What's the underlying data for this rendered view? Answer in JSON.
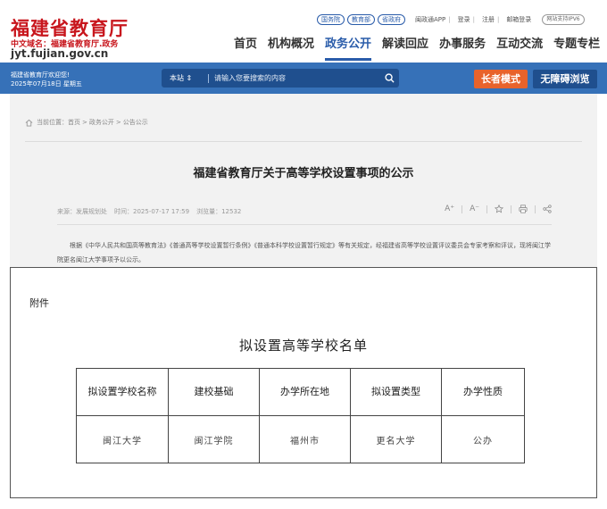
{
  "header": {
    "logo_title": "福建省教育厅",
    "logo_cn_domain": "中文域名：福建省教育厅.政务",
    "logo_domain": "jyt.fujian.gov.cn",
    "gov_links": [
      "国务院",
      "教育部",
      "省政府"
    ],
    "util_links": [
      "闽政通APP",
      "登录",
      "注册",
      "邮箱登录"
    ],
    "ipv6_badge": "网站支持IPV6",
    "nav": [
      {
        "label": "首页",
        "active": false
      },
      {
        "label": "机构概况",
        "active": false
      },
      {
        "label": "政务公开",
        "active": true
      },
      {
        "label": "解读回应",
        "active": false
      },
      {
        "label": "办事服务",
        "active": false
      },
      {
        "label": "互动交流",
        "active": false
      },
      {
        "label": "专题专栏",
        "active": false
      }
    ]
  },
  "bluebar": {
    "welcome": "福建省教育厅欢迎您!",
    "date": "2025年07月18日 星期五",
    "search_scope": "本站",
    "search_placeholder": "请输入您要搜索的内容",
    "elder_mode": "长者模式",
    "accessible": "无障碍浏览"
  },
  "article": {
    "breadcrumb_label": "当前位置：",
    "breadcrumb": [
      "首页",
      "政务公开",
      "公告公示"
    ],
    "title": "福建省教育厅关于高等学校设置事项的公示",
    "source": "来源：发展规划处",
    "time": "时间：2025-07-17 17:59",
    "views": "浏览量：12532",
    "tools": [
      "A⁺",
      "A⁻"
    ],
    "body": "根据《中华人民共和国高等教育法》《普通高等学校设置暂行条例》《普通本科学校设置暂行规定》等有关规定，经福建省高等学校设置评议委员会专家考察和评议，现将闽江学院更名闽江大学事项予以公示。"
  },
  "attachment": {
    "label": "附件",
    "list_title": "拟设置高等学校名单",
    "columns": [
      "拟设置学校名称",
      "建校基础",
      "办学所在地",
      "拟设置类型",
      "办学性质"
    ],
    "rows": [
      [
        "闽江大学",
        "闽江学院",
        "福州市",
        "更名大学",
        "公办"
      ]
    ]
  },
  "colors": {
    "brand_red": "#c8161d",
    "nav_blue": "#2a5caa",
    "bar_blue": "#3671b8",
    "elder_orange": "#e8632b"
  }
}
